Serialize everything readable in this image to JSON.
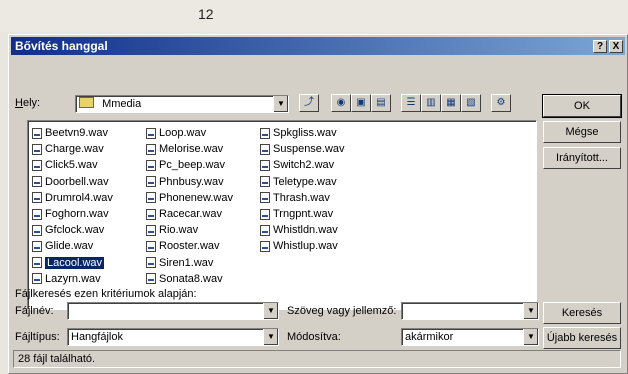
{
  "page_number": "12",
  "dialog": {
    "title": "Bővítés hanggal",
    "help_button": "?",
    "close_button": "X"
  },
  "location": {
    "label": "Hely:",
    "label_accel": "H",
    "label_rest": "ely:",
    "value": "Mmedia"
  },
  "files": {
    "col1": [
      "Beetvn9.wav",
      "Charge.wav",
      "Click5.wav",
      "Doorbell.wav",
      "Drumrol4.wav",
      "Foghorn.wav",
      "Gfclock.wav",
      "Glide.wav",
      "Lacool.wav",
      "Lazyrn.wav"
    ],
    "col2": [
      "Loop.wav",
      "Melorise.wav",
      "Pc_beep.wav",
      "Phnbusy.wav",
      "Phonenew.wav",
      "Racecar.wav",
      "Rio.wav",
      "Rooster.wav",
      "Siren1.wav",
      "Sonata8.wav"
    ],
    "col3": [
      "Spkgliss.wav",
      "Suspense.wav",
      "Switch2.wav",
      "Teletype.wav",
      "Thrash.wav",
      "Trngpnt.wav",
      "Whistldn.wav",
      "Whistlup.wav"
    ],
    "selected": "Lacool.wav"
  },
  "buttons": {
    "ok": "OK",
    "cancel": "Mégse",
    "advanced": "Irányított...",
    "search": "Keresés",
    "new_search": "Újabb keresés"
  },
  "criteria": {
    "heading": "Fájlkeresés ezen kritériumok alapján:",
    "filename_label": "Fájlnév:",
    "filename_value": "",
    "text_label": "Szöveg vagy jellemző:",
    "text_value": "",
    "filetype_label": "Fájltípus:",
    "filetype_value": "Hangfájlok",
    "modified_label": "Módosítva:",
    "modified_value": "akármikor"
  },
  "status": {
    "text": "28 fájl található."
  }
}
